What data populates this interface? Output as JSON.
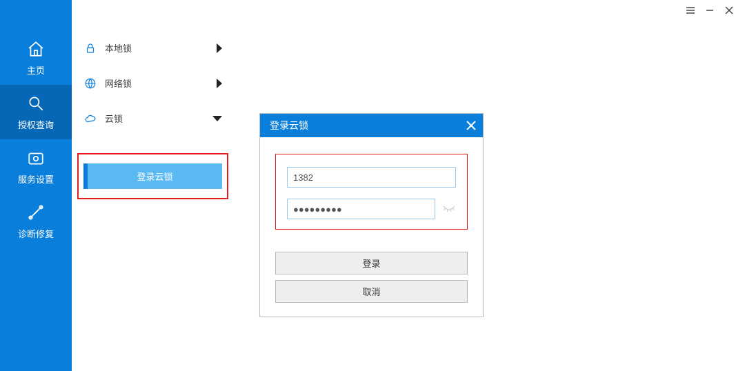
{
  "window_controls": {
    "menu": "menu",
    "minimize": "minimize",
    "close": "close"
  },
  "sidebar": {
    "items": [
      {
        "id": "home",
        "label": "主页"
      },
      {
        "id": "auth-query",
        "label": "授权查询"
      },
      {
        "id": "service-settings",
        "label": "服务设置"
      },
      {
        "id": "diagnose-repair",
        "label": "诊断修复"
      }
    ]
  },
  "list": {
    "items": [
      {
        "id": "local-lock",
        "label": "本地锁",
        "arrow": "right"
      },
      {
        "id": "network-lock",
        "label": "网络锁",
        "arrow": "right"
      },
      {
        "id": "cloud-lock",
        "label": "云锁",
        "arrow": "down"
      }
    ],
    "login_button_label": "登录云锁"
  },
  "dialog": {
    "title": "登录云锁",
    "username_value": "1382",
    "password_value": "●●●●●●●●●",
    "login_label": "登录",
    "cancel_label": "取消"
  }
}
